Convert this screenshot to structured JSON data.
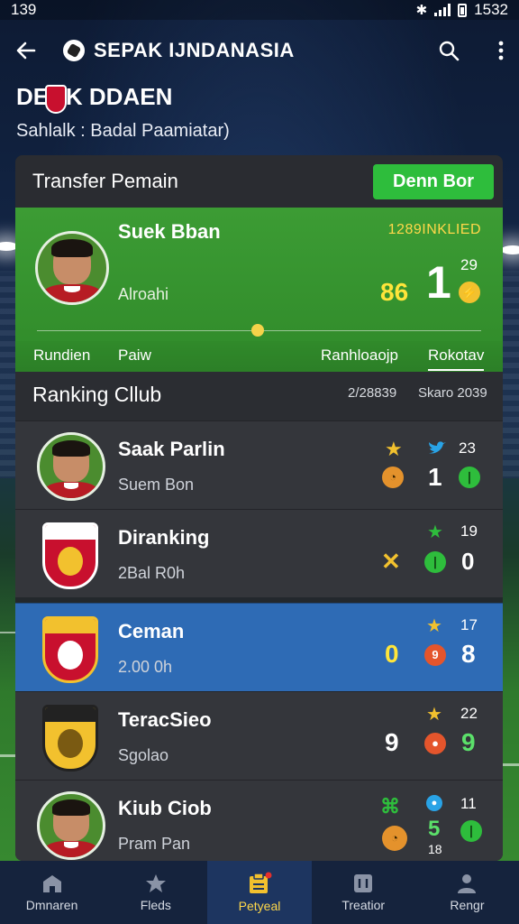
{
  "status_bar": {
    "time": "139",
    "clock": "1532"
  },
  "app_bar": {
    "title": "SEPAK IJNDANASIA"
  },
  "heading": {
    "title": "DEAK DDAEN",
    "subtitle": "Sahlalk : Badal Paamiatar)"
  },
  "panel": {
    "title": "Transfer Pemain",
    "action_label": "Denn Bor"
  },
  "feature": {
    "name": "Suek Bban",
    "subtitle": "Alroahi",
    "status": "1289INKLIED",
    "score_yellow": "86",
    "score_white": "1",
    "small_value": "29"
  },
  "subtabs": [
    "Rundien",
    "Paiw",
    "Ranhloaojp",
    "Rokotav"
  ],
  "ranking": {
    "title": "Ranking Cllub",
    "meta1": "2/28839",
    "meta2": "Skaro 2039",
    "rows": [
      {
        "name": "Saak Parlin",
        "sub": "Suem Bon",
        "top_value": "23",
        "main_value": "1",
        "highlighted": false
      },
      {
        "name": "Diranking",
        "sub": "2Bal R0h",
        "top_value": "19",
        "main_value": "0",
        "highlighted": false
      },
      {
        "name": "Ceman",
        "sub": "2.00 0h",
        "top_value": "17",
        "mid_value": "0",
        "main_value": "8",
        "highlighted": true
      },
      {
        "name": "TeracSieo",
        "sub": "Sgolao",
        "top_value": "22",
        "mid_value": "9",
        "main_value": "9",
        "highlighted": false
      },
      {
        "name": "Kiub Ciob",
        "sub": "Pram Pan",
        "top_value": "11",
        "mid_value": "5",
        "extra_value": "18",
        "highlighted": false
      }
    ]
  },
  "bottom_nav": [
    {
      "label": "Dmnaren",
      "active": false
    },
    {
      "label": "Fleds",
      "active": false
    },
    {
      "label": "Petyeal",
      "active": true
    },
    {
      "label": "Treatior",
      "active": false
    },
    {
      "label": "Rengr",
      "active": false
    }
  ],
  "colors": {
    "accent_green": "#2ebd3c",
    "highlight_blue": "#2e6bb5",
    "gold": "#ffd84a"
  }
}
